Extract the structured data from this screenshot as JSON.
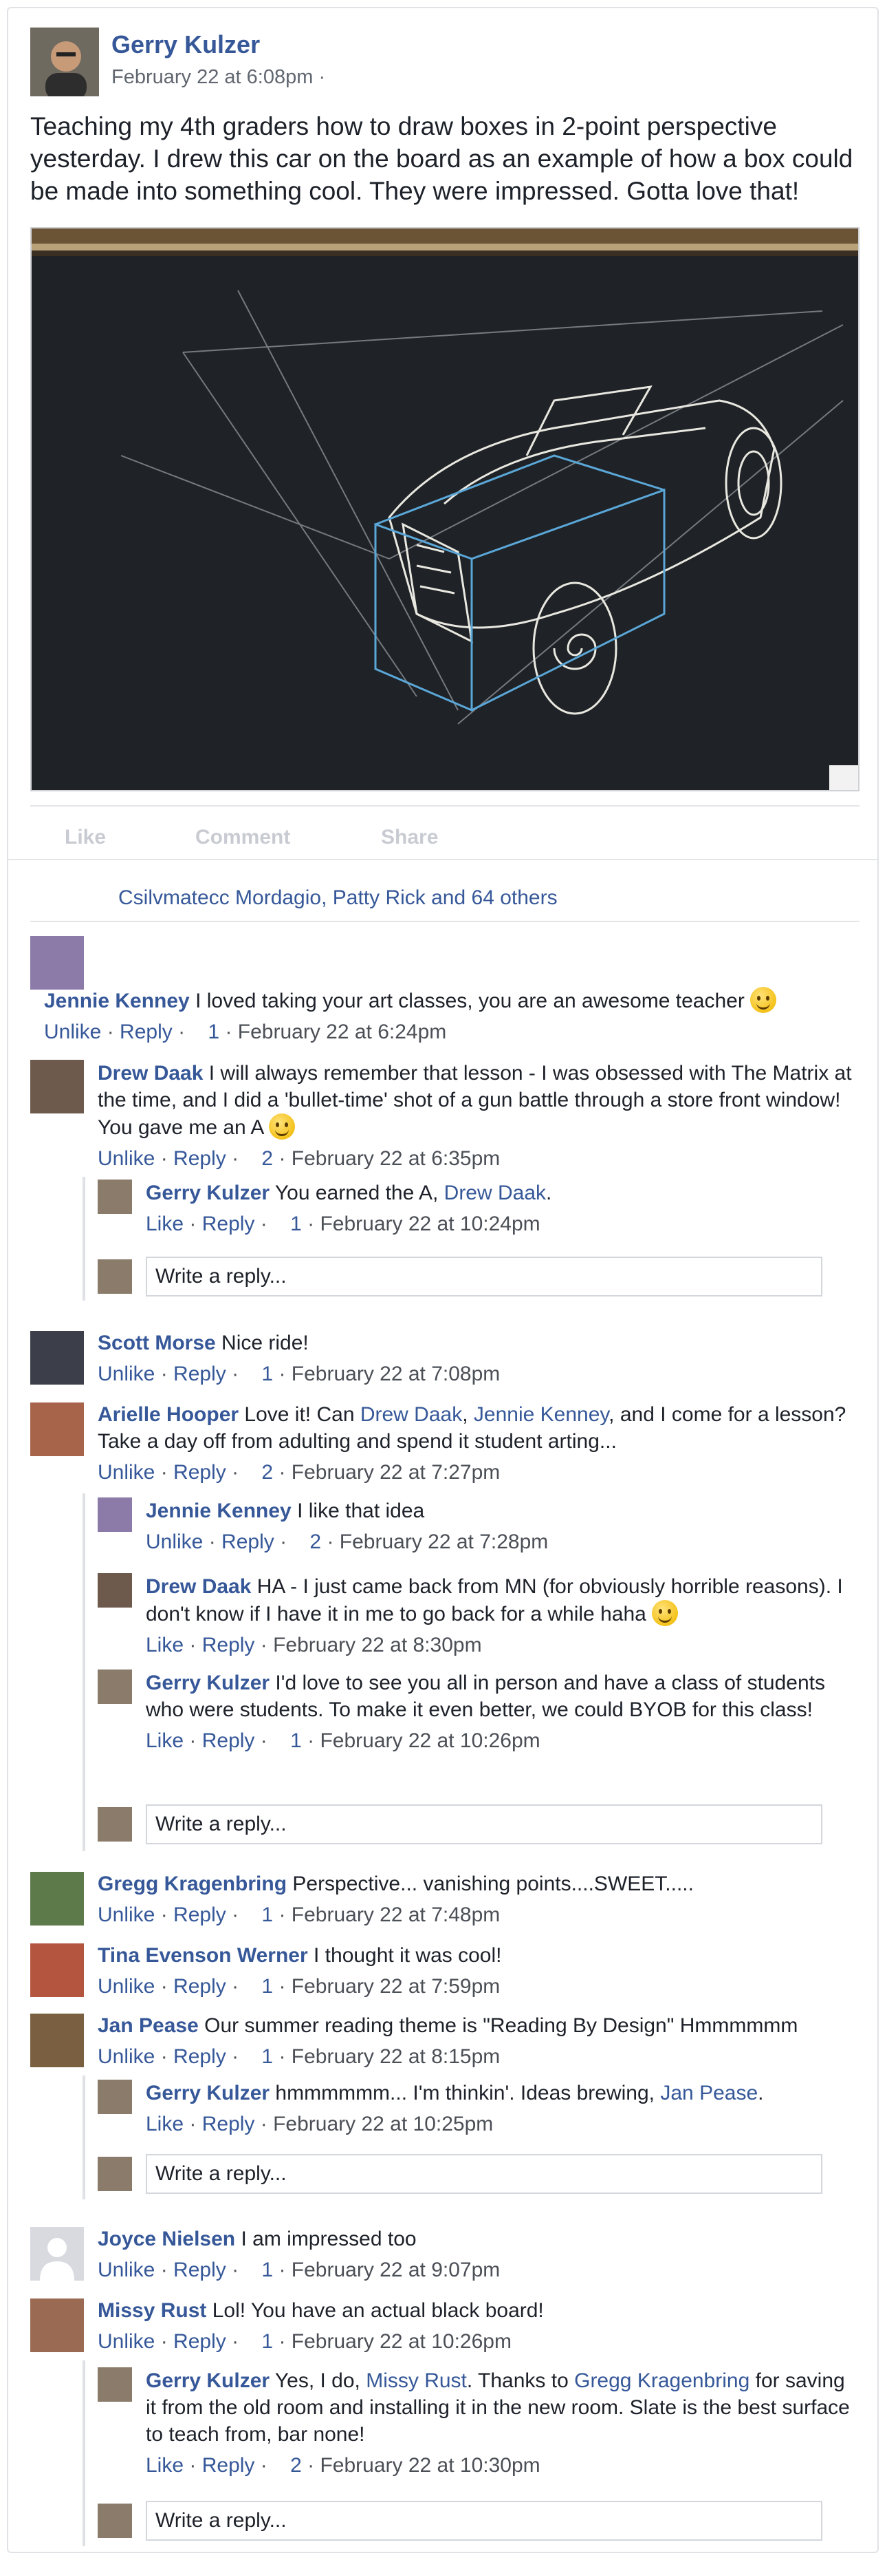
{
  "post": {
    "author": "Gerry Kulzer",
    "time": "February 22 at 6:08pm ·",
    "text": "Teaching my 4th graders how to draw boxes in 2-point perspective yesterday. I drew this car on the board as an example of how a box could be made into something cool. They were impressed. Gotta love that!",
    "photo_icon": "chalkboard-car-drawing"
  },
  "actions": {
    "like": "Like",
    "comment": "Comment",
    "share": "Share"
  },
  "likers": "Csilvmatecc Mordagio, Patty Rick and 64 others",
  "reply_placeholder": "Write a reply...",
  "comments": [
    {
      "name": "Jennie Kenney",
      "text": "I loved taking your art classes, you are an awesome teacher",
      "emoji": true,
      "unlike": "Unlike",
      "reply": "Reply",
      "likes": "1",
      "time": "February 22 at 6:24pm"
    },
    {
      "name": "Drew Daak",
      "text": "I will always remember that lesson - I was obsessed with The Matrix at the time, and I did a 'bullet-time' shot of a gun battle through a store front window! You gave me an A",
      "emoji": true,
      "unlike": "Unlike",
      "reply": "Reply",
      "likes": "2",
      "time": "February 22 at 6:35pm",
      "replies": [
        {
          "name": "Gerry Kulzer",
          "text": "You earned the A,",
          "tag": "Drew Daak",
          "tail": ".",
          "like": "Like",
          "reply": "Reply",
          "likes": "1",
          "time": "February 22 at 10:24pm"
        }
      ]
    },
    {
      "name": "Scott Morse",
      "text": "Nice ride!",
      "unlike": "Unlike",
      "reply": "Reply",
      "likes": "1",
      "time": "February 22 at 7:08pm"
    },
    {
      "name": "Arielle Hooper",
      "text_a": "Love it! Can",
      "tag1": "Drew Daak",
      "sep": ",",
      "tag2": "Jennie Kenney",
      "text_b": ", and I come for a lesson? Take a day off from adulting and spend it student arting...",
      "unlike": "Unlike",
      "reply": "Reply",
      "likes": "2",
      "time": "February 22 at 7:27pm",
      "replies": [
        {
          "name": "Jennie Kenney",
          "text": "I like that idea",
          "unlike": "Unlike",
          "reply": "Reply",
          "likes": "2",
          "time": "February 22 at 7:28pm"
        },
        {
          "name": "Drew Daak",
          "text": "HA - I just came back from MN (for obviously horrible reasons). I don't know if I have it in me to go back for a while haha",
          "emoji": true,
          "like": "Like",
          "reply": "Reply",
          "time": "February 22 at 8:30pm"
        },
        {
          "name": "Gerry Kulzer",
          "text": "I'd love to see you all in person and have a class of students who were students. To make it even better, we could BYOB for this class!",
          "like": "Like",
          "reply": "Reply",
          "likes": "1",
          "time": "February 22 at 10:26pm"
        }
      ]
    },
    {
      "name": "Gregg Kragenbring",
      "text": "Perspective... vanishing points....SWEET.....",
      "unlike": "Unlike",
      "reply": "Reply",
      "likes": "1",
      "time": "February 22 at 7:48pm"
    },
    {
      "name": "Tina Evenson Werner",
      "text": "I thought it was cool!",
      "unlike": "Unlike",
      "reply": "Reply",
      "likes": "1",
      "time": "February 22 at 7:59pm"
    },
    {
      "name": "Jan Pease",
      "text": "Our summer reading theme is \"Reading By Design\" Hmmmmmm",
      "unlike": "Unlike",
      "reply": "Reply",
      "likes": "1",
      "time": "February 22 at 8:15pm",
      "replies": [
        {
          "name": "Gerry Kulzer",
          "text": "hmmmmmm... I'm thinkin'. Ideas brewing,",
          "tag": "Jan Pease",
          "tail": ".",
          "like": "Like",
          "reply": "Reply",
          "time": "February 22 at 10:25pm"
        }
      ]
    },
    {
      "name": "Joyce Nielsen",
      "text": "I am impressed too",
      "unlike": "Unlike",
      "reply": "Reply",
      "likes": "1",
      "time": "February 22 at 9:07pm"
    },
    {
      "name": "Missy Rust",
      "text": "Lol! You have an actual black board!",
      "unlike": "Unlike",
      "reply": "Reply",
      "likes": "1",
      "time": "February 22 at 10:26pm",
      "replies": [
        {
          "name": "Gerry Kulzer",
          "text_a": "Yes, I do,",
          "tag1": "Missy Rust",
          "text_m": ". Thanks to",
          "tag2": "Gregg Kragenbring",
          "text_b": "for saving it from the old room and installing it in the new room. Slate is the best surface to teach from, bar none!",
          "like": "Like",
          "reply": "Reply",
          "likes": "2",
          "time": "February 22 at 10:30pm"
        }
      ]
    }
  ]
}
